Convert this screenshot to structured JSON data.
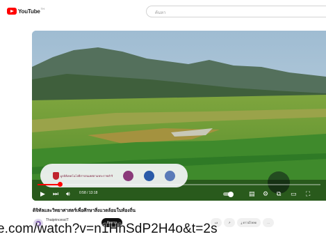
{
  "header": {
    "logo_text": "YouTube",
    "logo_sup": "TH",
    "search_placeholder": "ค้นหา"
  },
  "player": {
    "time": "0:58 / 13:18",
    "progress": 0.078,
    "banner_text": "มูลนิธิเทคโนโลยีสารสนเทศตามพระราชดำริ"
  },
  "video": {
    "title": "ดิจิทัลและวิทยาศาสตร์เพื่อศึกษาสิ่งแวดล้อมในท้องถิ่น",
    "channel": "ThaiprincessIT",
    "subscribe_label": "ติดตาม",
    "action_labels": [
      "",
      "",
      "",
      "ดาวน์โหลด",
      ""
    ]
  },
  "url_overlay": "e.com/watch?v=n1HhSdP2H4o&t=2s",
  "colors": {
    "brand_red": "#ff0000",
    "progress": "#ff0000"
  }
}
